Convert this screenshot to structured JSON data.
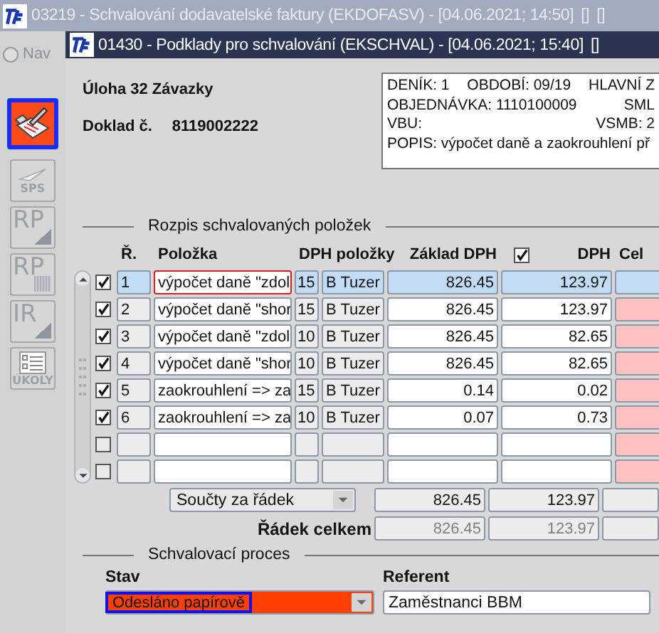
{
  "outer_window": {
    "title": "03219 - Schvalování dodavatelské faktury (EKDOFASV) - [04.06.2021; 14:50]",
    "title_buttons": [
      "[]",
      "[]"
    ]
  },
  "sidebar": {
    "nav": {
      "label": "Nav",
      "selected": false
    },
    "tools": [
      {
        "kind": "pen",
        "selected": true
      },
      {
        "kind": "sps",
        "label": "SPS",
        "selected": false
      },
      {
        "kind": "rp",
        "label": "RP",
        "selected": false
      },
      {
        "kind": "rp_grid",
        "label": "RP",
        "selected": false
      },
      {
        "kind": "ir",
        "label": "IR",
        "selected": false
      },
      {
        "kind": "tasks",
        "label": "ÚKOLY",
        "selected": false
      }
    ]
  },
  "window": {
    "title": "01430 - Podklady pro schvalování (EKSCHVAL) - [04.06.2021; 15:40]",
    "title_buttons": [
      "[]"
    ]
  },
  "header": {
    "task": "Úloha 32 Závazky",
    "doc_label": "Doklad č.",
    "doc_number": "8119002222",
    "info_lines": [
      [
        "DENÍK: 1",
        "OBDOBÍ: 09/19",
        "HLAVNÍ Z"
      ],
      [
        "OBJEDNÁVKA: 1110100009",
        "SML"
      ],
      [
        "VBU:",
        "VSMB: 2"
      ],
      [
        "POPIS: výpočet daně a zaokrouhlení př"
      ]
    ]
  },
  "table": {
    "title": "Rozpis schvalovaných položek",
    "columns": [
      {
        "label": "Ř."
      },
      {
        "label": "Položka"
      },
      {
        "label": "DPH položky"
      },
      {
        "label": "Základ DPH"
      },
      {
        "label": "DPH",
        "checked": true
      },
      {
        "label": "Cel"
      }
    ],
    "rows": [
      {
        "checked": true,
        "selected": true,
        "number": "1",
        "item": "výpočet daně \"zdol",
        "vat_rate": "15",
        "vat_type": "B  Tuzer",
        "base": "826.45",
        "vat": "123.97"
      },
      {
        "checked": true,
        "selected": false,
        "number": "2",
        "item": "výpočet daně \"shor",
        "vat_rate": "15",
        "vat_type": "B  Tuzer",
        "base": "826.45",
        "vat": "123.97"
      },
      {
        "checked": true,
        "selected": false,
        "number": "3",
        "item": "výpočet daně \"zdol",
        "vat_rate": "10",
        "vat_type": "B  Tuzer",
        "base": "826.45",
        "vat": "82.65"
      },
      {
        "checked": true,
        "selected": false,
        "number": "4",
        "item": "výpočet daně \"shor",
        "vat_rate": "10",
        "vat_type": "B  Tuzer",
        "base": "826.45",
        "vat": "82.65"
      },
      {
        "checked": true,
        "selected": false,
        "number": "5",
        "item": "zaokrouhlení => za",
        "vat_rate": "15",
        "vat_type": "B  Tuzer",
        "base": "0.14",
        "vat": "0.02"
      },
      {
        "checked": true,
        "selected": false,
        "number": "6",
        "item": "zaokrouhlení => za",
        "vat_rate": "10",
        "vat_type": "B  Tuzer",
        "base": "0.07",
        "vat": "0.73"
      },
      {
        "checked": false,
        "selected": false
      },
      {
        "checked": false,
        "selected": false
      }
    ],
    "totals_select": "Součty za řádek",
    "totals": [
      "826.45",
      "123.97"
    ],
    "row_total_label": "Řádek celkem",
    "row_totals": [
      "826.45",
      "123.97"
    ]
  },
  "approval": {
    "title": "Schvalovací proces",
    "status_label": "Stav",
    "status": "Odesláno papírově",
    "referent_label": "Referent",
    "referent": "Zaměstnanci BBM"
  }
}
